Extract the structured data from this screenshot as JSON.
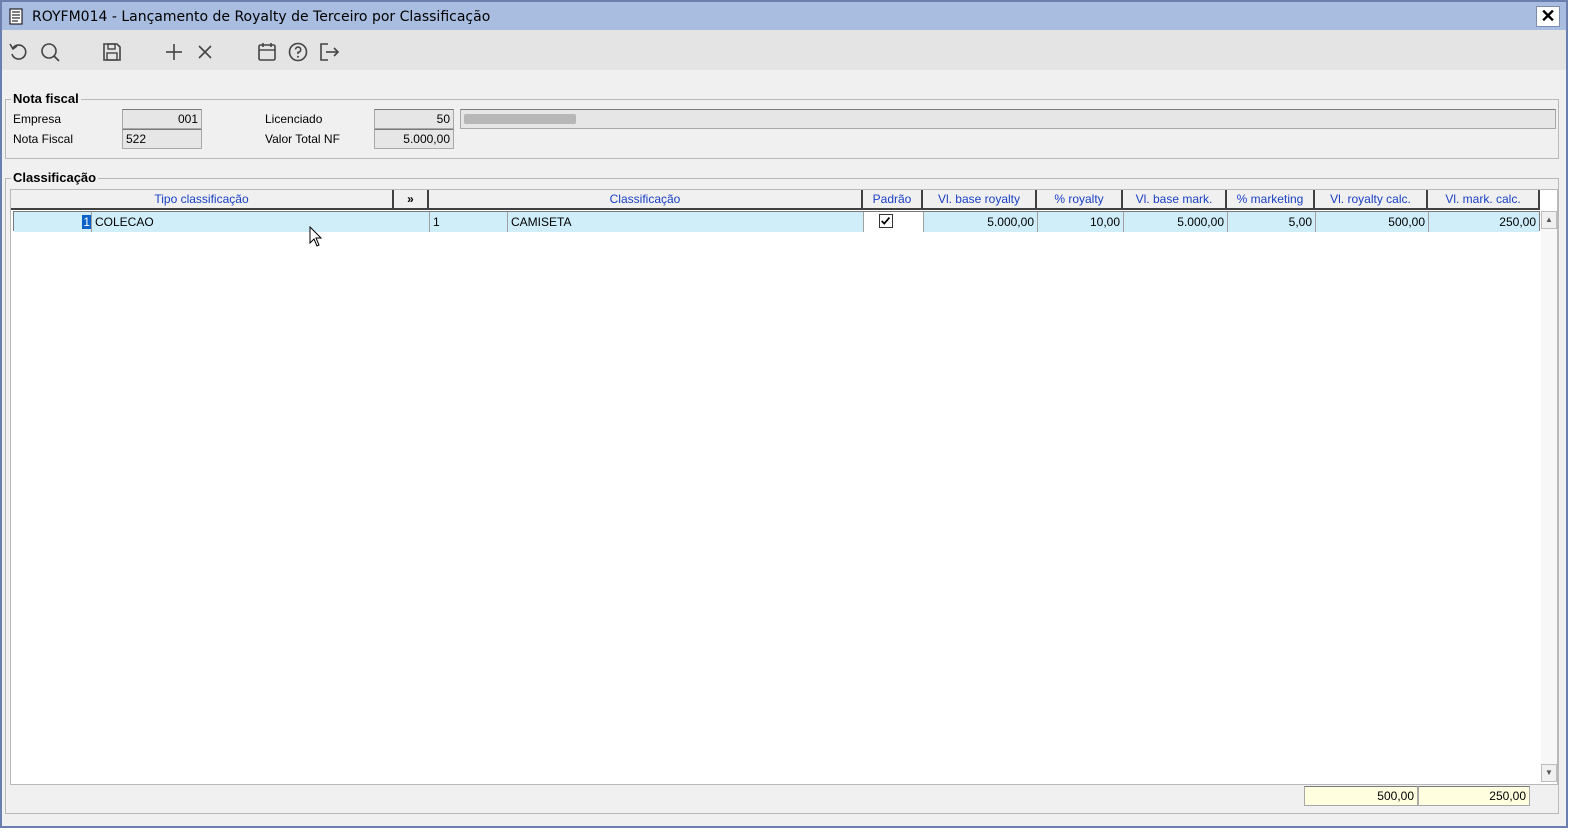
{
  "window": {
    "title": "ROYFM014 - Lançamento de Royalty de Terceiro por Classificação",
    "close_label": "✕"
  },
  "toolbar": {
    "icons": [
      "refresh-icon",
      "search-icon",
      "save-icon",
      "add-icon",
      "delete-icon",
      "calendar-icon",
      "help-icon",
      "exit-icon"
    ]
  },
  "nota_fiscal": {
    "legend": "Nota fiscal",
    "empresa_label": "Empresa",
    "empresa_value": "001",
    "nota_fiscal_label": "Nota Fiscal",
    "nota_fiscal_value": "522",
    "licenciado_label": "Licenciado",
    "licenciado_value": "50",
    "valor_total_label": "Valor Total NF",
    "valor_total_value": "5.000,00"
  },
  "classificacao": {
    "legend": "Classificação",
    "headers": {
      "tipo": "Tipo classificação",
      "expand": "»",
      "classificacao": "Classificação",
      "padrao": "Padrão",
      "vl_base_royalty": "Vl. base royalty",
      "pct_royalty": "% royalty",
      "vl_base_mark": "Vl. base mark.",
      "pct_marketing": "% marketing",
      "vl_royalty_calc": "Vl. royalty calc.",
      "vl_mark_calc": "Vl. mark. calc."
    },
    "rows": [
      {
        "tipo_code": "1",
        "tipo_desc": "COLECAO",
        "class_code": "1",
        "class_desc": "CAMISETA",
        "padrao": true,
        "vl_base_royalty": "5.000,00",
        "pct_royalty": "10,00",
        "vl_base_mark": "5.000,00",
        "pct_marketing": "5,00",
        "vl_royalty_calc": "500,00",
        "vl_mark_calc": "250,00"
      }
    ],
    "totals": {
      "royalty": "500,00",
      "marketing": "250,00"
    }
  },
  "colors": {
    "titlebar": "#a8bde0",
    "header_text": "#1a3fc4",
    "selected_row": "#cfeefa",
    "totals_bg": "#ffffe0"
  }
}
